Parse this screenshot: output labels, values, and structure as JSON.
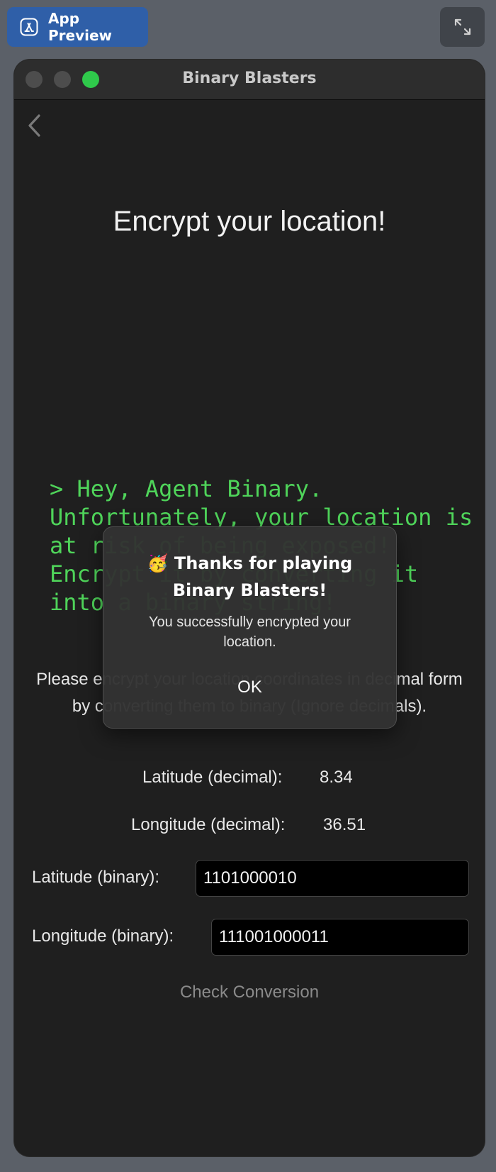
{
  "toolbar": {
    "app_preview_label": "App Preview",
    "app_icon": "app-store-icon",
    "expand_icon": "expand-icon"
  },
  "window": {
    "title": "Binary Blasters",
    "back_icon": "chevron-left-icon"
  },
  "main": {
    "heading": "Encrypt your location!",
    "terminal_text": "> Hey, Agent Binary. Unfortunately, your location is at risk of being exposed! Encrypt it by converting it into a binary string!",
    "instructions": "Please encrypt your location coordinates in decimal form by converting them to binary (Ignore decimals).",
    "lat_decimal_label": "Latitude (decimal):",
    "lat_decimal_value": "8.34",
    "lon_decimal_label": "Longitude (decimal):",
    "lon_decimal_value": "36.51",
    "lat_binary_label": "Latitude (binary):",
    "lat_binary_value": "1101000010",
    "lon_binary_label": "Longitude (binary):",
    "lon_binary_value": "111001000011",
    "check_button": "Check Conversion"
  },
  "dialog": {
    "title": "🥳 Thanks for playing Binary Blasters!",
    "message": "You successfully encrypted your location.",
    "ok": "OK"
  },
  "colors": {
    "terminal_green": "#4fd45a",
    "accent_blue": "#2f5fa8",
    "traffic_green": "#2fc94b"
  }
}
